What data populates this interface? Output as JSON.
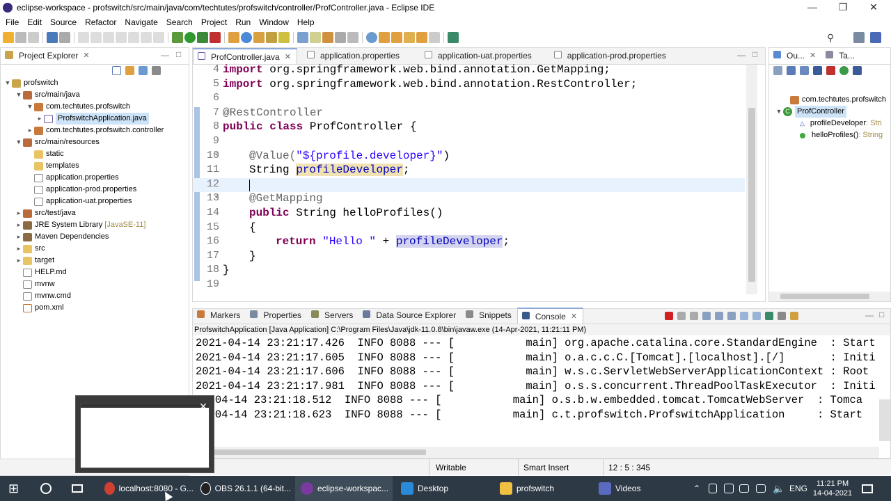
{
  "window": {
    "title": "eclipse-workspace - profswitch/src/main/java/com/techtutes/profswitch/controller/ProfController.java - Eclipse IDE"
  },
  "menu": [
    "File",
    "Edit",
    "Source",
    "Refactor",
    "Navigate",
    "Search",
    "Project",
    "Run",
    "Window",
    "Help"
  ],
  "explorer": {
    "tab": "Project Explorer",
    "items": [
      {
        "label": "profswitch",
        "icon": "project-icon"
      },
      {
        "label": "src/main/java",
        "icon": "package-folder-icon"
      },
      {
        "label": "com.techtutes.profswitch",
        "icon": "package-icon"
      },
      {
        "label": "ProfswitchApplication.java",
        "icon": "java-file-icon"
      },
      {
        "label": "com.techtutes.profswitch.controller",
        "icon": "package-icon"
      },
      {
        "label": "src/main/resources",
        "icon": "package-folder-icon"
      },
      {
        "label": "static",
        "icon": "folder-icon"
      },
      {
        "label": "templates",
        "icon": "folder-icon"
      },
      {
        "label": "application.properties",
        "icon": "file-icon"
      },
      {
        "label": "application-prod.properties",
        "icon": "file-icon"
      },
      {
        "label": "application-uat.properties",
        "icon": "file-icon"
      },
      {
        "label": "src/test/java",
        "icon": "package-folder-icon"
      },
      {
        "label": "JRE System Library",
        "suffix": "[JavaSE-11]",
        "icon": "library-icon"
      },
      {
        "label": "Maven Dependencies",
        "icon": "library-icon"
      },
      {
        "label": "src",
        "icon": "folder-icon"
      },
      {
        "label": "target",
        "icon": "folder-icon"
      },
      {
        "label": "HELP.md",
        "icon": "file-icon"
      },
      {
        "label": "mvnw",
        "icon": "file-icon"
      },
      {
        "label": "mvnw.cmd",
        "icon": "file-icon"
      },
      {
        "label": "pom.xml",
        "icon": "file-icon"
      }
    ]
  },
  "editor": {
    "tabs": [
      "ProfController.java",
      "application.properties",
      "application-uat.properties",
      "application-prod.properties"
    ],
    "lines": {
      "n4": "4",
      "l4a": "import",
      "l4b": " org.springframework.web.bind.annotation.GetMapping;",
      "n5": "5",
      "l5a": "import",
      "l5b": " org.springframework.web.bind.annotation.RestController;",
      "n6": "6",
      "n7": "7",
      "l7": "@RestController",
      "n8": "8",
      "l8a": "public",
      "l8b": "class",
      "l8c": " ProfController {",
      "n9": "9",
      "n10": "10",
      "l10a": "@Value(",
      "l10b": "\"${profile.developer}\"",
      "l10c": ")",
      "n11": "11",
      "l11a": "String ",
      "l11b": "profileDeveloper",
      "l11c": ";",
      "n12": "12",
      "n13": "13",
      "l13": "@GetMapping",
      "n14": "14",
      "l14a": "public",
      "l14b": " String helloProfiles()",
      "n15": "15",
      "l15": "{",
      "n16": "16",
      "l16a": "return",
      "l16b": "\"Hello \"",
      "l16c": " + ",
      "l16d": "profileDeveloper",
      "l16e": ";",
      "n17": "17",
      "l17": "}",
      "n18": "18",
      "l18": "}",
      "n19": "19"
    }
  },
  "outline": {
    "tabs": [
      "Ou...",
      "Ta..."
    ],
    "items": [
      {
        "label": "com.techtutes.profswitch",
        "suffix": ""
      },
      {
        "label": "ProfController",
        "suffix": ""
      },
      {
        "label": "profileDeveloper",
        "suffix": " : Stri"
      },
      {
        "label": "helloProfiles()",
        "suffix": " : String"
      }
    ]
  },
  "bottom": {
    "tabs": [
      "Markers",
      "Properties",
      "Servers",
      "Data Source Explorer",
      "Snippets",
      "Console"
    ],
    "header": "ProfswitchApplication [Java Application] C:\\Program Files\\Java\\jdk-11.0.8\\bin\\javaw.exe  (14-Apr-2021, 11:21:11 PM)",
    "console": [
      "2021-04-14 23:21:17.426  INFO 8088 --- [           main] org.apache.catalina.core.StandardEngine  : Start",
      "2021-04-14 23:21:17.605  INFO 8088 --- [           main] o.a.c.c.C.[Tomcat].[localhost].[/]       : Initi",
      "2021-04-14 23:21:17.606  INFO 8088 --- [           main] w.s.c.ServletWebServerApplicationContext : Root ",
      "2021-04-14 23:21:17.981  INFO 8088 --- [           main] o.s.s.concurrent.ThreadPoolTaskExecutor  : Initi",
      "-1-04-14 23:21:18.512  INFO 8088 --- [           main] o.s.b.w.embedded.tomcat.TomcatWebServer  : Tomca",
      "-1-04-14 23:21:18.623  INFO 8088 --- [           main] c.t.profswitch.ProfswitchApplication     : Start"
    ]
  },
  "status": {
    "writable": "Writable",
    "insert": "Smart Insert",
    "position": "12 : 5 : 345"
  },
  "taskbar": {
    "items": [
      "localhost:8080 - G...",
      "OBS 26.1.1 (64-bit...",
      "eclipse-workspac...",
      "Desktop",
      "profswitch",
      "Videos"
    ],
    "lang": "ENG",
    "time": "11:21 PM",
    "date": "14-04-2021"
  }
}
